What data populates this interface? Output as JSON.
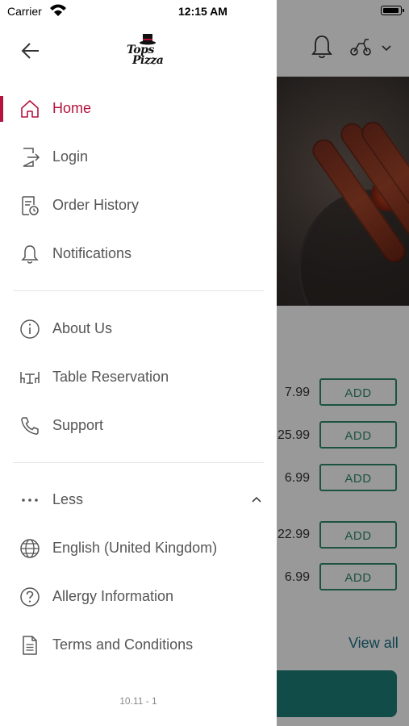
{
  "status_bar": {
    "carrier": "Carrier",
    "time": "12:15 AM"
  },
  "brand": {
    "logo_line1": "Tops",
    "logo_line2": "Pizza",
    "accent_color": "#b3133d"
  },
  "drawer": {
    "items": [
      {
        "label": "Home",
        "icon": "home-icon",
        "active": true
      },
      {
        "label": "Login",
        "icon": "login-icon"
      },
      {
        "label": "Order History",
        "icon": "order-history-icon"
      },
      {
        "label": "Notifications",
        "icon": "bell-icon"
      },
      {
        "label": "About Us",
        "icon": "info-icon"
      },
      {
        "label": "Table Reservation",
        "icon": "table-icon"
      },
      {
        "label": "Support",
        "icon": "phone-icon"
      },
      {
        "label": "Less",
        "icon": "more-dots-icon"
      },
      {
        "label": "English (United Kingdom)",
        "icon": "globe-icon"
      },
      {
        "label": "Allergy Information",
        "icon": "question-icon"
      },
      {
        "label": "Terms and Conditions",
        "icon": "document-icon"
      }
    ],
    "version": "10.11 - 1"
  },
  "background": {
    "prices": [
      "7.99",
      "25.99",
      "6.99",
      "22.99",
      "6.99"
    ],
    "add_label": "ADD",
    "view_all": "View all",
    "button_color": "#2f8a6c"
  }
}
